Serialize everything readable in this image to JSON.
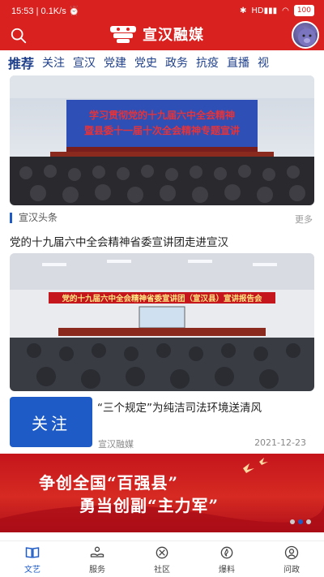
{
  "status_bar": {
    "time": "15:53",
    "speed": "0.1K/s",
    "battery": "100",
    "signal_text": "HD"
  },
  "header": {
    "app_name": "宣汉融媒"
  },
  "tabs": [
    "推荐",
    "关注",
    "宣汉",
    "党建",
    "党史",
    "政务",
    "抗疫",
    "直播",
    "视"
  ],
  "feed": {
    "image1_banner_text": [
      "学习贯彻党的十九届六中全会精神",
      "暨县委十一届十次全会精神专题宣讲"
    ],
    "section_title": "宣汉头条",
    "more_label": "更多",
    "headline1": "党的十九届六中全会精神省委宣讲团走进宣汉",
    "image2_banner_text": "党的十九届六中全会精神省委宣讲团（宣汉县）宣讲报告会",
    "follow_label": "关注",
    "headline2": "“三个规定”为纯洁司法环境送清风",
    "source": "宣汉融媒",
    "date": "2021-12-23"
  },
  "banner": {
    "line1": "争创全国“百强县”",
    "line2": "勇当创副“主力军”"
  },
  "bottom_nav": [
    {
      "label": "文艺",
      "icon": "book-icon"
    },
    {
      "label": "服务",
      "icon": "service-hand-icon"
    },
    {
      "label": "社区",
      "icon": "community-icon"
    },
    {
      "label": "爆料",
      "icon": "fire-icon"
    },
    {
      "label": "问政",
      "icon": "person-icon"
    }
  ],
  "colors": {
    "brand_red": "#d9211f",
    "accent_blue": "#1e5bc6",
    "tab_text": "#1e3f8a"
  }
}
